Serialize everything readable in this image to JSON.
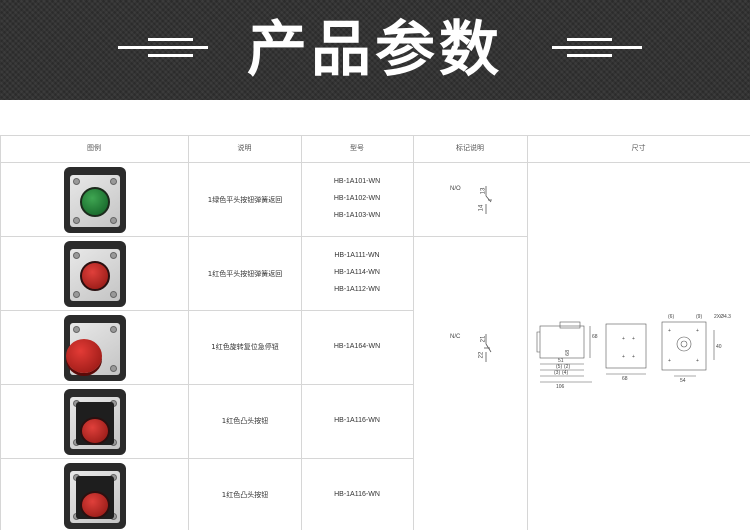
{
  "banner": {
    "title": "产品参数"
  },
  "table": {
    "headers": [
      "图例",
      "说明",
      "型号",
      "标记说明",
      "尺寸"
    ],
    "rows": [
      {
        "description": "1绿色平头按钮弹簧返回",
        "models": [
          "HB-1A101-WN",
          "HB-1A102-WN",
          "HB-1A103-WN"
        ],
        "button": "green-flush"
      },
      {
        "description": "1红色平头按钮弹簧返回",
        "models": [
          "HB-1A111-WN",
          "HB-1A114-WN",
          "HB-1A112-WN"
        ],
        "button": "red-flush"
      },
      {
        "description": "1红色旋转复位急停钮",
        "models": [
          "HB-1A164-WN"
        ],
        "button": "red-mushroom"
      },
      {
        "description": "1红色凸头按钮",
        "models": [
          "HB-1A116-WN"
        ],
        "button": "red-raised"
      },
      {
        "description": "1红色凸头按钮",
        "models": [
          "HB-1A116-WN"
        ],
        "button": "red-raised"
      }
    ],
    "symbols": {
      "no": {
        "label": "N/O",
        "terminals": [
          "13",
          "14"
        ]
      },
      "nc": {
        "label": "N/C",
        "terminals": [
          "21",
          "22"
        ]
      }
    },
    "dimensions": {
      "side_labels": [
        "51",
        "(5)",
        "(2)",
        "(3)",
        "(4)",
        "106",
        "68"
      ],
      "front_label": "68",
      "back_labels": [
        "(6)",
        "(9)",
        "2XØ4.3",
        "40",
        "54"
      ]
    }
  }
}
